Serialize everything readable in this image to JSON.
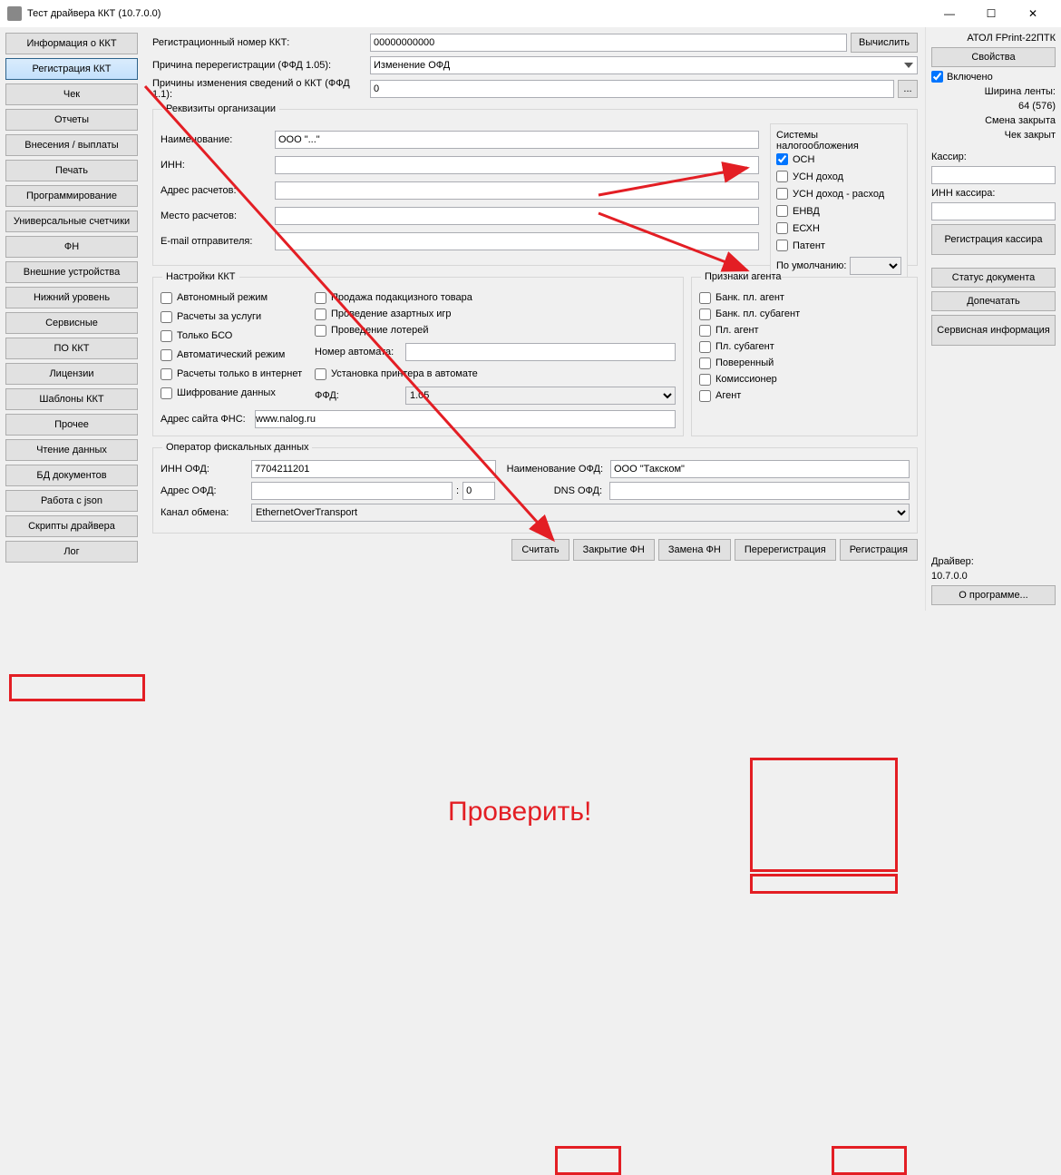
{
  "window": {
    "title": "Тест драйвера ККТ (10.7.0.0)"
  },
  "nav": [
    "Информация о ККТ",
    "Регистрация ККТ",
    "Чек",
    "Отчеты",
    "Внесения / выплаты",
    "Печать",
    "Программирование",
    "Универсальные счетчики",
    "ФН",
    "Внешние устройства",
    "Нижний уровень",
    "Сервисные",
    "ПО ККТ",
    "Лицензии",
    "Шаблоны ККТ",
    "Прочее",
    "Чтение данных",
    "БД документов",
    "Работа с json",
    "Скрипты драйвера",
    "Лог"
  ],
  "nav_selected": 1,
  "top": {
    "reg_label": "Регистрационный номер ККТ:",
    "reg_value": "00000000000",
    "compute": "Вычислить",
    "rereg_label": "Причина перерегистрации (ФФД 1.05):",
    "rereg_value": "Изменение ОФД",
    "change_label": "Причины изменения сведений о ККТ (ФФД 1.1):",
    "change_value": "0",
    "ellipsis": "..."
  },
  "org": {
    "legend": "Реквизиты организации",
    "name_label": "Наименование:",
    "name_value": "ООО \"...\"",
    "inn_label": "ИНН:",
    "inn_value": "",
    "addr_label": "Адрес расчетов:",
    "addr_value": "",
    "place_label": "Место расчетов:",
    "place_value": "",
    "email_label": "E-mail отправителя:",
    "email_value": ""
  },
  "tax": {
    "legend": "Системы налогообложения",
    "items": [
      "ОСН",
      "УСН доход",
      "УСН доход - расход",
      "ЕНВД",
      "ЕСХН",
      "Патент"
    ],
    "checked": [
      true,
      false,
      false,
      false,
      false,
      false
    ],
    "default_label": "По умолчанию:",
    "default_value": ""
  },
  "kkt": {
    "legend": "Настройки ККТ",
    "col1": [
      "Автономный режим",
      "Расчеты за услуги",
      "Только БСО",
      "Автоматический режим",
      "Расчеты только в интернет",
      "Шифрование данных"
    ],
    "col2": [
      "Продажа подакцизного товара",
      "Проведение азартных игр",
      "Проведение лотерей"
    ],
    "automat_label": "Номер автомата:",
    "automat_value": "",
    "printer_label": "Установка принтера в автомате",
    "ffd_label": "ФФД:",
    "ffd_value": "1.05",
    "fns_label": "Адрес сайта ФНС:",
    "fns_value": "www.nalog.ru"
  },
  "agent": {
    "legend": "Признаки агента",
    "items": [
      "Банк. пл. агент",
      "Банк. пл. субагент",
      "Пл. агент",
      "Пл. субагент",
      "Поверенный",
      "Комиссионер",
      "Агент"
    ]
  },
  "ofd": {
    "legend": "Оператор фискальных данных",
    "inn_label": "ИНН ОФД:",
    "inn_value": "7704211201",
    "name_label": "Наименование ОФД:",
    "name_value": "ООО \"Такском\"",
    "addr_label": "Адрес ОФД:",
    "addr_value": "",
    "port_value": "0",
    "dns_label": "DNS ОФД:",
    "dns_value": "",
    "channel_label": "Канал обмена:",
    "channel_value": "EthernetOverTransport"
  },
  "buttons": {
    "read": "Считать",
    "close_fn": "Закрытие ФН",
    "replace_fn": "Замена ФН",
    "rereg": "Перерегистрация",
    "reg": "Регистрация"
  },
  "right": {
    "device": "АТОЛ FPrint-22ПТК",
    "props": "Свойства",
    "enabled": "Включено",
    "width1": "Ширина ленты:",
    "width2": "64 (576)",
    "shift": "Смена закрыта",
    "cheque": "Чек закрыт",
    "cashier_label": "Кассир:",
    "cashier_inn_label": "ИНН кассира:",
    "reg_cashier": "Регистрация кассира",
    "doc_status": "Статус документа",
    "reprint": "Допечатать",
    "service_info": "Сервисная информация",
    "driver_label": "Драйвер:",
    "driver_ver": "10.7.0.0",
    "about": "О программе..."
  },
  "annotation_text": "Проверить!"
}
